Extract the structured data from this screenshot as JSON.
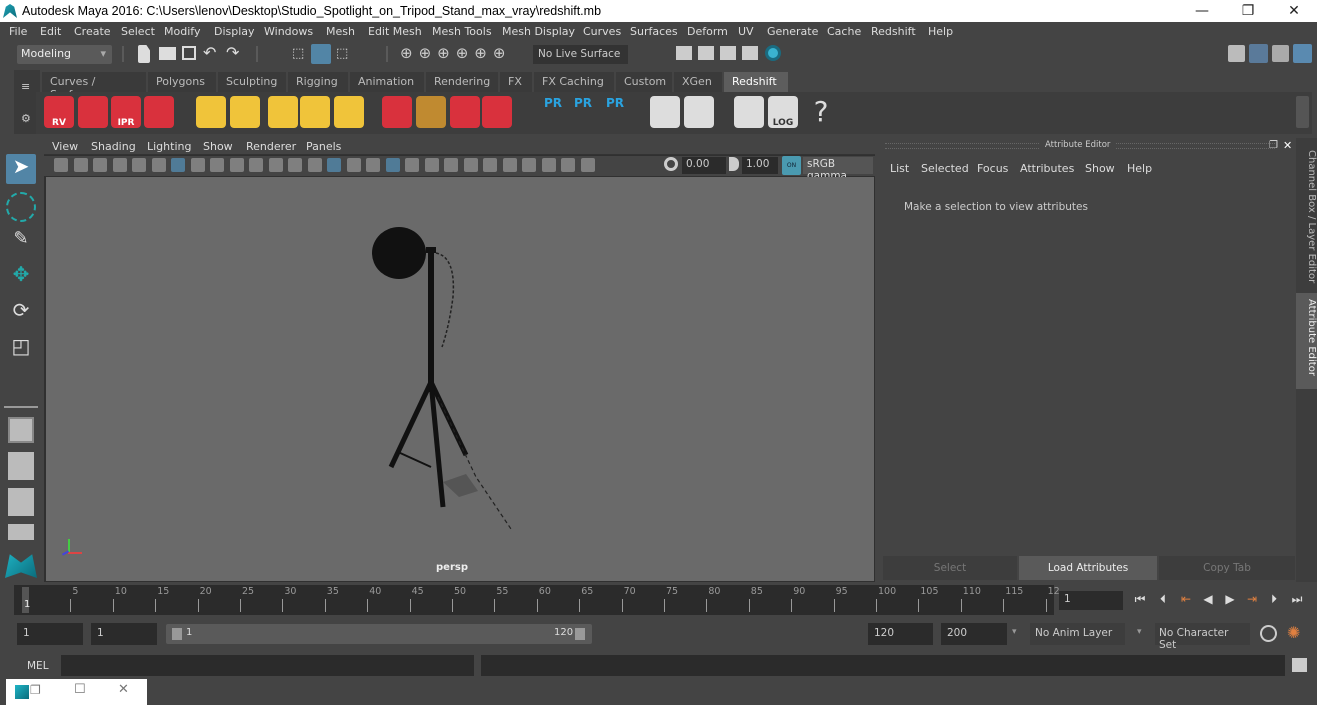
{
  "window": {
    "title": "Autodesk Maya 2016: C:\\Users\\lenov\\Desktop\\Studio_Spotlight_on_Tripod_Stand_max_vray\\redshift.mb",
    "minimize": "—",
    "restore": "❐",
    "close": "✕"
  },
  "menubar": [
    "File",
    "Edit",
    "Create",
    "Select",
    "Modify",
    "Display",
    "Windows",
    "Mesh",
    "Edit Mesh",
    "Mesh Tools",
    "Mesh Display",
    "Curves",
    "Surfaces",
    "Deform",
    "UV",
    "Generate",
    "Cache",
    "Redshift",
    "Help"
  ],
  "toolbar": {
    "mode": "Modeling",
    "live_surface": "No Live Surface"
  },
  "shelf": {
    "tabs": [
      "Curves / Surfaces",
      "Polygons",
      "Sculpting",
      "Rigging",
      "Animation",
      "Rendering",
      "FX",
      "FX Caching",
      "Custom",
      "XGen",
      "Redshift"
    ],
    "active": "Redshift",
    "icons": [
      {
        "name": "rv-icon",
        "label": "RV",
        "color": "#d9313d"
      },
      {
        "name": "render-sequence-icon",
        "label": "",
        "color": "#d9313d"
      },
      {
        "name": "ipr-icon",
        "label": "IPR",
        "color": "#d9313d"
      },
      {
        "name": "render-settings-icon",
        "label": "",
        "color": "#d9313d"
      },
      {
        "name": "diamond-light-icon",
        "label": "",
        "color": "#f0c43a"
      },
      {
        "name": "area-light-icon",
        "label": "",
        "color": "#f0c43a"
      },
      {
        "name": "spot-light-icon",
        "label": "",
        "color": "#f0c43a"
      },
      {
        "name": "dome-light-icon",
        "label": "",
        "color": "#f0c43a"
      },
      {
        "name": "sun-sky-icon",
        "label": "",
        "color": "#f0c43a"
      },
      {
        "name": "volume-icon",
        "label": "",
        "color": "#d9313d"
      },
      {
        "name": "hair-icon",
        "label": "",
        "color": "#c08a30"
      },
      {
        "name": "curve-shader-icon",
        "label": "",
        "color": "#d9313d"
      },
      {
        "name": "sphere-shader-icon",
        "label": "",
        "color": "#d9313d"
      },
      {
        "name": "pr-mesh-icon",
        "label": "PR",
        "color": "#2aa3e0"
      },
      {
        "name": "pr-export-icon",
        "label": "PR",
        "color": "#2aa3e0"
      },
      {
        "name": "pr-swap-icon",
        "label": "PR",
        "color": "#2aa3e0"
      },
      {
        "name": "bake-pies-icon",
        "label": "",
        "color": "#ddd"
      },
      {
        "name": "bake-pie-icon",
        "label": "",
        "color": "#ddd"
      },
      {
        "name": "script-icon",
        "label": "",
        "color": "#ddd"
      },
      {
        "name": "log-icon",
        "label": "LOG",
        "color": "#ddd"
      },
      {
        "name": "help-icon",
        "label": "?",
        "color": "#ddd"
      }
    ]
  },
  "viewport": {
    "menu": [
      "View",
      "Shading",
      "Lighting",
      "Show",
      "Renderer",
      "Panels"
    ],
    "exposure": "0.00",
    "gamma": "1.00",
    "color_space": "sRGB gamma",
    "camera": "persp",
    "on_label": "ON"
  },
  "attribute_editor": {
    "title": "Attribute Editor",
    "menu": [
      "List",
      "Selected",
      "Focus",
      "Attributes",
      "Show",
      "Help"
    ],
    "message": "Make a selection to view attributes",
    "buttons": [
      "Select",
      "Load Attributes",
      "Copy Tab"
    ]
  },
  "side_tabs": [
    "Channel Box / Layer Editor",
    "Attribute Editor"
  ],
  "timeline": {
    "ticks": [
      "5",
      "10",
      "15",
      "20",
      "25",
      "30",
      "35",
      "40",
      "45",
      "50",
      "55",
      "60",
      "65",
      "70",
      "75",
      "80",
      "85",
      "90",
      "95",
      "100",
      "105",
      "110",
      "115",
      "12"
    ],
    "current": "1",
    "frame_field": "1"
  },
  "range": {
    "start": "1",
    "playback_start": "1",
    "slider_start": "1",
    "slider_end": "120",
    "playback_end": "120",
    "end": "200",
    "anim_layer": "No Anim Layer",
    "character_set": "No Character Set"
  },
  "command": {
    "label": "MEL",
    "input": "",
    "output": ""
  },
  "taskbar": {
    "restore": "❐",
    "maximize": "☐",
    "close": "✕"
  }
}
